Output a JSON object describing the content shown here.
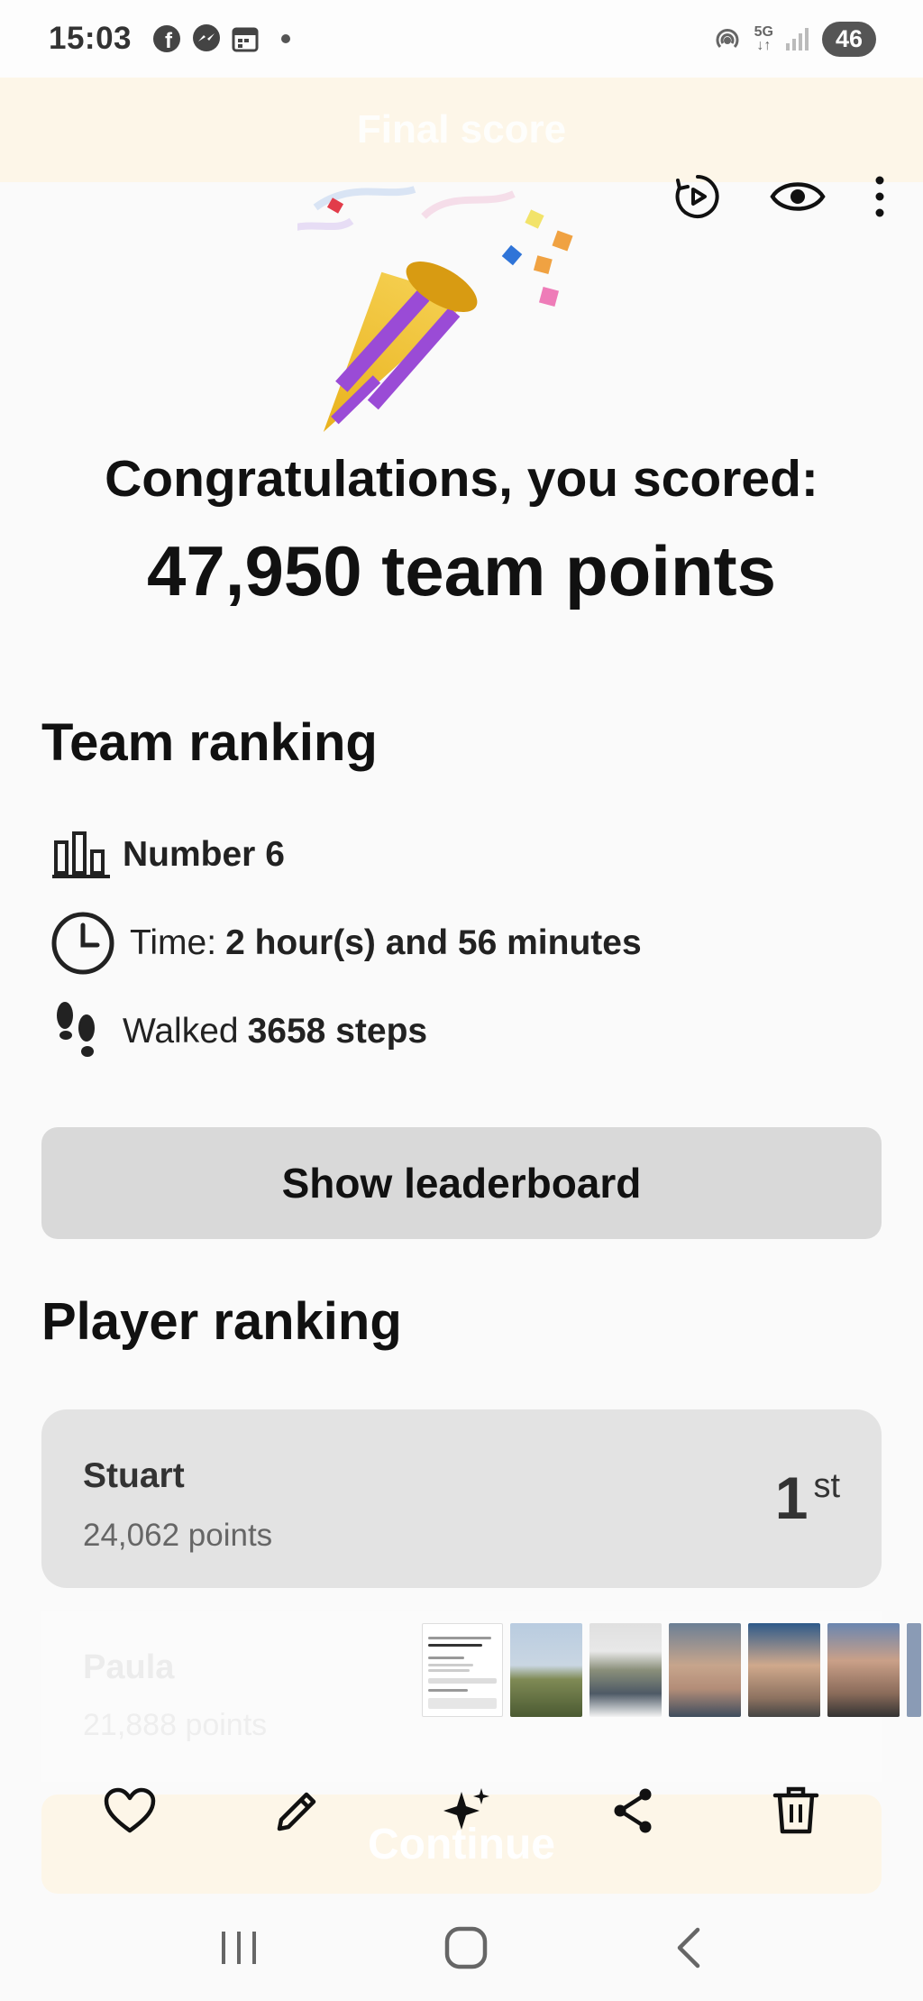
{
  "status_bar": {
    "time": "15:03",
    "left_icons": [
      "facebook-icon",
      "messenger-icon",
      "calendar-icon",
      "dot-icon"
    ],
    "right_icons": [
      "hotspot-icon",
      "5g-icon",
      "signal-icon"
    ],
    "network": "5G",
    "battery": "46"
  },
  "header": {
    "title": "Final score"
  },
  "viewer_actions": [
    "remaster-icon",
    "eye-icon",
    "more-icon"
  ],
  "result": {
    "congrats": "Congratulations, you scored:",
    "score": "47,950 team points"
  },
  "team_ranking": {
    "title": "Team ranking",
    "rank_label": "Number 6",
    "time_prefix": "Time: ",
    "time_value": "2 hour(s) and 56 minutes",
    "steps_prefix": "Walked ",
    "steps_value": "3658 steps",
    "leaderboard_button": "Show leaderboard"
  },
  "player_ranking": {
    "title": "Player ranking",
    "players": [
      {
        "name": "Stuart",
        "points": "24,062 points",
        "place": "1",
        "suffix": "st"
      },
      {
        "name": "Paula",
        "points": "21,888 points"
      }
    ]
  },
  "continue_label": "Continue",
  "gallery_actions": [
    "heart-icon",
    "edit-icon",
    "sparkle-icon",
    "share-icon",
    "trash-icon"
  ],
  "colors": {
    "header_bg": "#fdf6e8",
    "card_bg": "#e3e3e3",
    "button_bg": "#d9d9d9"
  }
}
